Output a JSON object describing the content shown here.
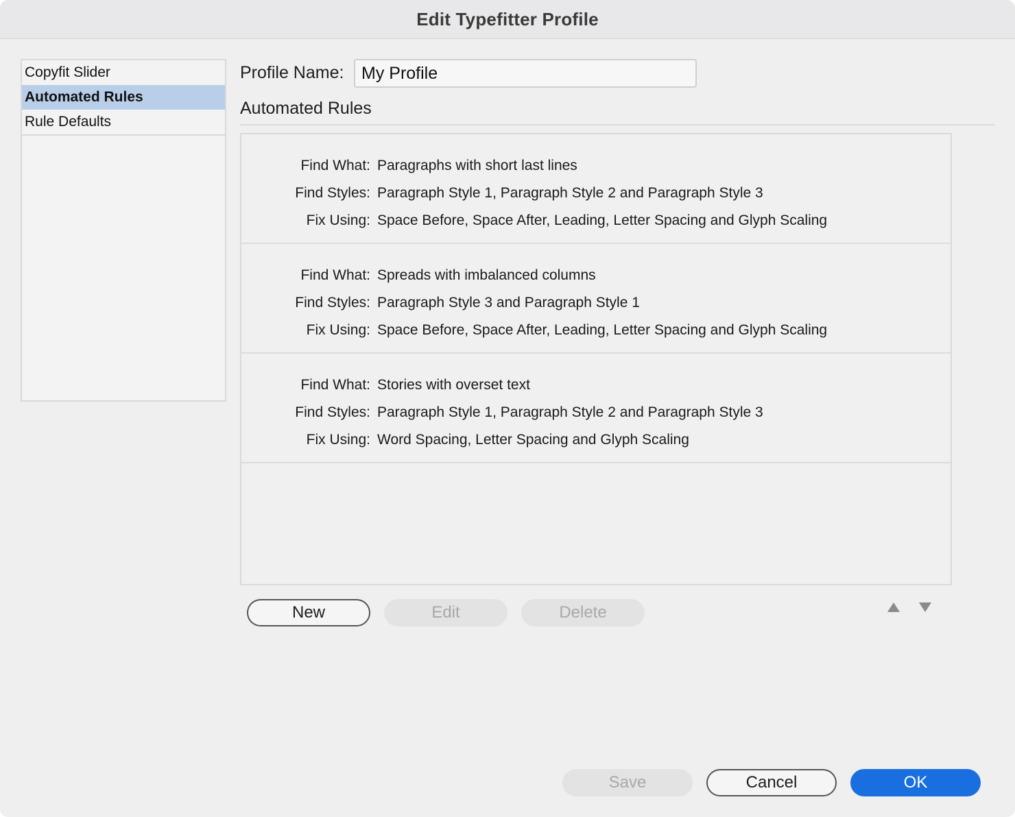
{
  "window": {
    "title": "Edit Typefitter Profile"
  },
  "sidebar": {
    "items": [
      {
        "label": "Copyfit Slider"
      },
      {
        "label": "Automated Rules"
      },
      {
        "label": "Rule Defaults"
      }
    ],
    "selected": "Automated Rules"
  },
  "profile": {
    "label": "Profile Name:",
    "value": "My Profile"
  },
  "section": {
    "heading": "Automated Rules"
  },
  "rules": [
    {
      "find_what_label": "Find What:",
      "find_what": "Paragraphs with short last lines",
      "find_styles_label": "Find Styles:",
      "find_styles": "Paragraph Style 1, Paragraph Style 2 and Paragraph Style 3",
      "fix_using_label": "Fix Using:",
      "fix_using": "Space Before, Space After, Leading, Letter Spacing and Glyph Scaling"
    },
    {
      "find_what_label": "Find What:",
      "find_what": "Spreads with imbalanced columns",
      "find_styles_label": "Find Styles:",
      "find_styles": "Paragraph Style 3 and Paragraph Style 1",
      "fix_using_label": "Fix Using:",
      "fix_using": "Space Before, Space After, Leading, Letter Spacing and Glyph Scaling"
    },
    {
      "find_what_label": "Find What:",
      "find_what": "Stories with overset text",
      "find_styles_label": "Find Styles:",
      "find_styles": "Paragraph Style 1, Paragraph Style 2 and Paragraph Style 3",
      "fix_using_label": "Fix Using:",
      "fix_using": "Word Spacing, Letter Spacing and Glyph Scaling"
    }
  ],
  "list_buttons": {
    "new": "New",
    "edit": "Edit",
    "delete": "Delete"
  },
  "reorder": {
    "up_icon": "triangle-up-icon",
    "down_icon": "triangle-down-icon"
  },
  "footer": {
    "save": "Save",
    "cancel": "Cancel",
    "ok": "OK"
  },
  "colors": {
    "accent": "#1a6fe0",
    "selection": "#b9cfe9"
  }
}
